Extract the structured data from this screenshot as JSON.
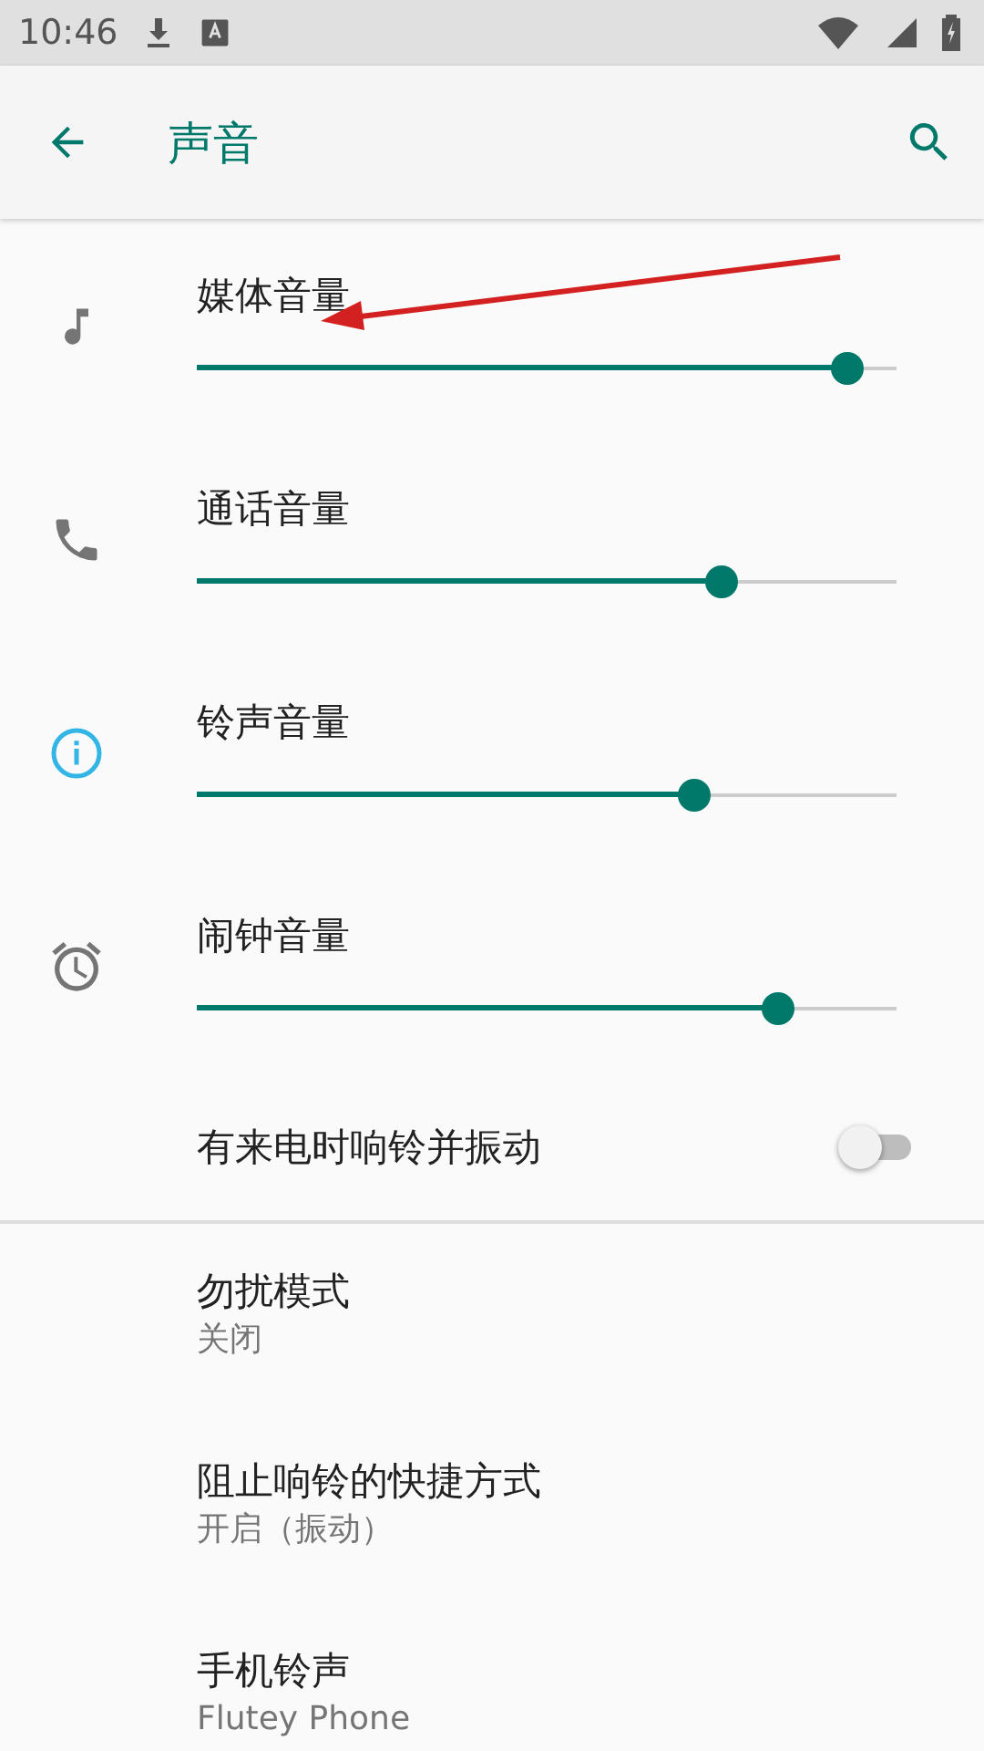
{
  "status_bar": {
    "time": "10:46"
  },
  "toolbar": {
    "title": "声音"
  },
  "volume_sliders": [
    {
      "label": "媒体音量",
      "kind": "music",
      "level": 0.93
    },
    {
      "label": "通话音量",
      "kind": "phone",
      "level": 0.75
    },
    {
      "label": "铃声音量",
      "kind": "info",
      "level": 0.71
    },
    {
      "label": "闹钟音量",
      "kind": "alarm",
      "level": 0.83
    }
  ],
  "vibrate_toggle": {
    "label": "有来电时响铃并振动",
    "on": false
  },
  "settings": [
    {
      "title": "勿扰模式",
      "summary": "关闭"
    },
    {
      "title": "阻止响铃的快捷方式",
      "summary": "开启（振动）"
    },
    {
      "title": "手机铃声",
      "summary": "Flutey Phone"
    }
  ]
}
